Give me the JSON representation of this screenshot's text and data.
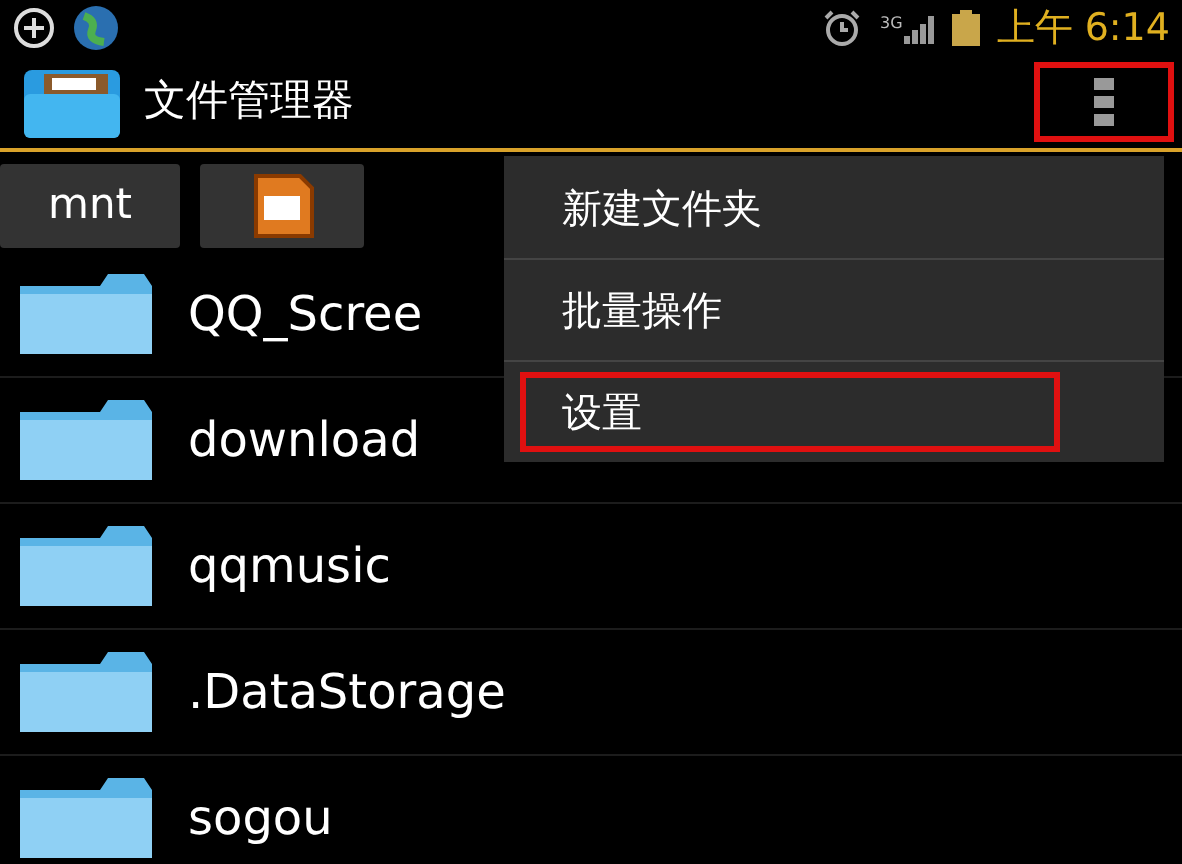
{
  "status_bar": {
    "time": "上午 6:14",
    "network": "3G"
  },
  "action_bar": {
    "title": "文件管理器",
    "overflow_highlighted": true
  },
  "breadcrumbs": [
    {
      "kind": "text",
      "label": "mnt"
    },
    {
      "kind": "sdcard"
    }
  ],
  "folders": [
    {
      "name": "QQ_Scree"
    },
    {
      "name": "download"
    },
    {
      "name": "qqmusic"
    },
    {
      "name": ".DataStorage"
    },
    {
      "name": "sogou"
    }
  ],
  "menu": [
    {
      "label": "新建文件夹",
      "highlighted": false
    },
    {
      "label": "批量操作",
      "highlighted": false
    },
    {
      "label": "设置",
      "highlighted": true
    }
  ]
}
